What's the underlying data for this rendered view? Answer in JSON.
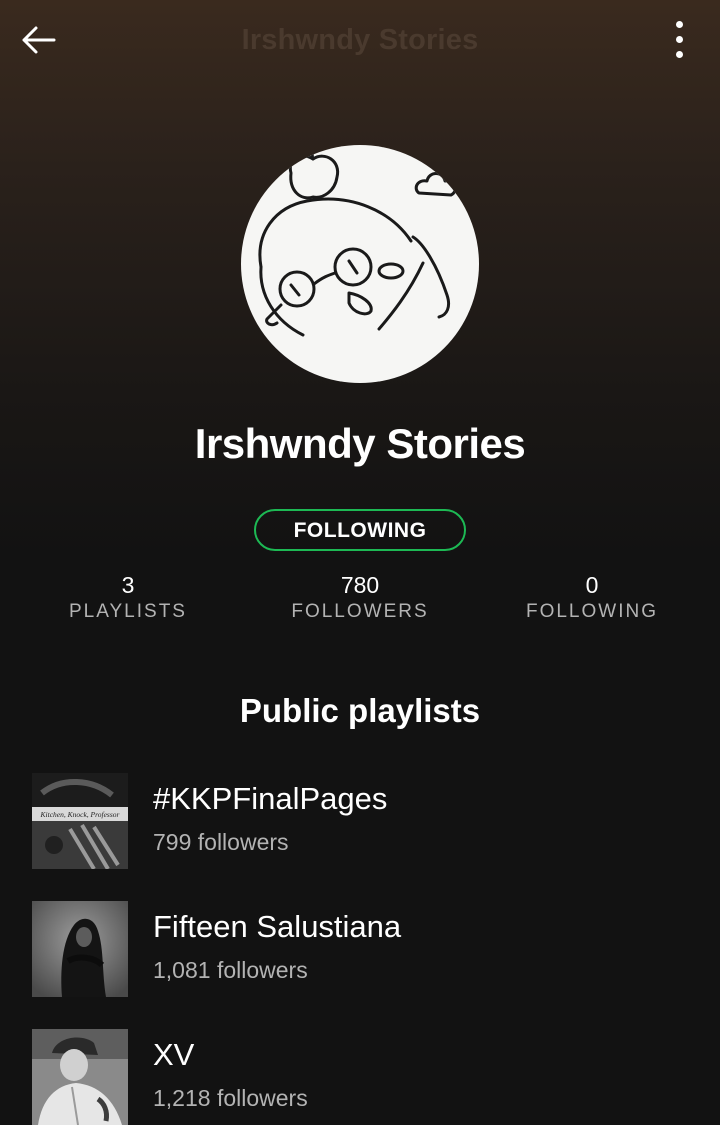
{
  "header": {
    "title": "Irshwndy Stories",
    "back_icon": "arrow-left-icon",
    "more_icon": "more-vertical-icon"
  },
  "profile": {
    "name": "Irshwndy Stories",
    "follow_button_label": "FOLLOWING",
    "avatar": "cartoon-face-with-glasses"
  },
  "stats": [
    {
      "value": "3",
      "label": "PLAYLISTS"
    },
    {
      "value": "780",
      "label": "FOLLOWERS"
    },
    {
      "value": "0",
      "label": "FOLLOWING"
    }
  ],
  "section": {
    "title": "Public playlists"
  },
  "playlists": [
    {
      "name": "#KKPFinalPages",
      "followers": "799 followers",
      "cover_text": "Kitchen, Knock, Professor"
    },
    {
      "name": "Fifteen Salustiana",
      "followers": "1,081 followers"
    },
    {
      "name": "XV",
      "followers": "1,218 followers"
    }
  ],
  "colors": {
    "accent": "#1db954",
    "background": "#121212",
    "secondary_text": "#b3b3b3"
  }
}
